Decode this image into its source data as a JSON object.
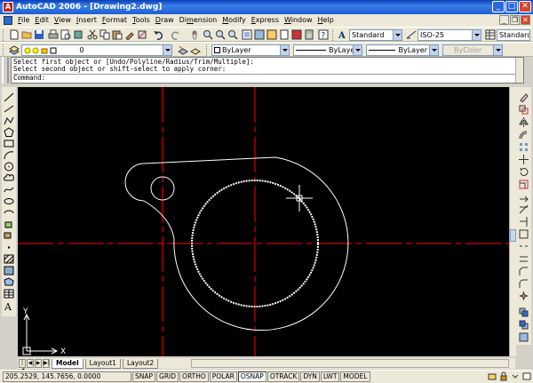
{
  "window": {
    "title": "AutoCAD 2006 - [Drawing2.dwg]",
    "app_icon_letter": "A"
  },
  "menu": [
    {
      "label": "File",
      "u": "F",
      "rest": "ile"
    },
    {
      "label": "Edit",
      "u": "E",
      "rest": "dit"
    },
    {
      "label": "View",
      "u": "V",
      "rest": "iew"
    },
    {
      "label": "Insert",
      "u": "I",
      "rest": "nsert"
    },
    {
      "label": "Format",
      "u": "F",
      "rest": "ormat",
      "pre": ""
    },
    {
      "label": "Tools",
      "u": "T",
      "rest": "ools"
    },
    {
      "label": "Draw",
      "u": "D",
      "rest": "raw"
    },
    {
      "label": "Dimension",
      "pre": "Di",
      "u": "m",
      "rest": "ension"
    },
    {
      "label": "Modify",
      "u": "M",
      "rest": "odify"
    },
    {
      "label": "Express",
      "u": "E",
      "rest": "xpress"
    },
    {
      "label": "Window",
      "u": "W",
      "rest": "indow"
    },
    {
      "label": "Help",
      "u": "H",
      "rest": "elp"
    }
  ],
  "toolbar1": {
    "text_style": "Standard",
    "dim_style": "ISO-25",
    "table_style": "Standard"
  },
  "toolbar2": {
    "layer": "0",
    "color": "ByLayer",
    "linetype": "ByLayer",
    "lineweight": "ByLayer",
    "plotstyle": "ByColor"
  },
  "command": {
    "line1": "Select first object or [Undo/Polyline/Radius/Trim/Multiple]:",
    "line2": "Select second object or shift-select to apply corner:",
    "prompt": "Command:"
  },
  "ucs": {
    "x_label": "X",
    "y_label": "Y"
  },
  "tabs": {
    "model": "Model",
    "layout1": "Layout1",
    "layout2": "Layout2"
  },
  "status": {
    "coords": "205.2529, 145.7656, 0.0000",
    "buttons": [
      "SNAP",
      "GRID",
      "ORTHO",
      "POLAR",
      "OSNAP",
      "OTRACK",
      "DYN",
      "LWT",
      "MODEL"
    ]
  },
  "colors": {
    "canvas": "#000000",
    "centerline": "#ff0000",
    "geometry": "#ffffff",
    "titlebar": "#1b5fd8"
  }
}
